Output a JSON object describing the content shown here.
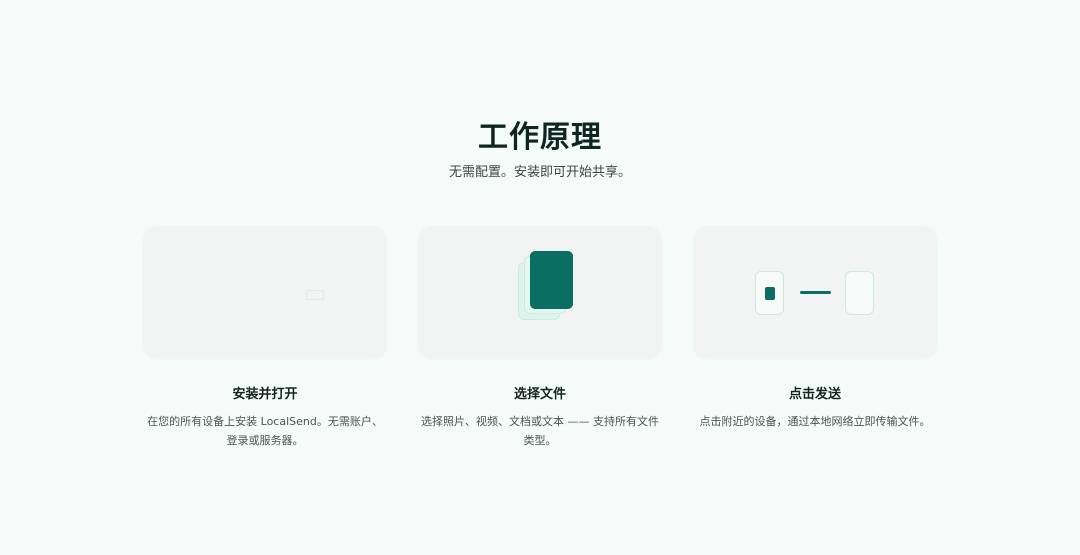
{
  "section": {
    "title": "工作原理",
    "subtitle": "无需配置。安装即可开始共享。"
  },
  "steps": [
    {
      "title": "安装并打开",
      "description": "在您的所有设备上安装 LocalSend。无需账户、登录或服务器。",
      "illustration": "install-icon"
    },
    {
      "title": "选择文件",
      "description": "选择照片、视频、文档或文本 —— 支持所有文件类型。",
      "illustration": "file-stack-icon"
    },
    {
      "title": "点击发送",
      "description": "点击附近的设备，通过本地网络立即传输文件。",
      "illustration": "device-connection-icon"
    }
  ],
  "colors": {
    "background": "#f4fbf8",
    "card": "#f1f4f3",
    "accent": "#0a6e62",
    "accent_light": "#def3ec"
  }
}
